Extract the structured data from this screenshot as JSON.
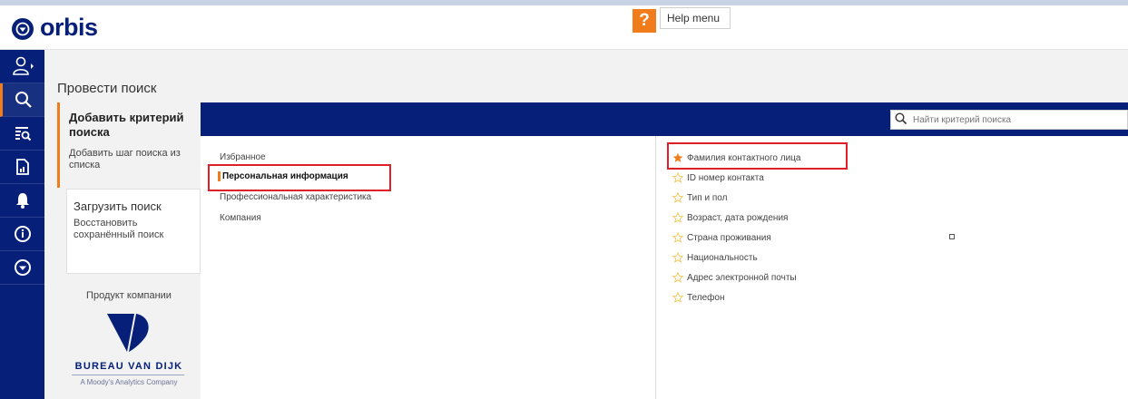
{
  "app": {
    "name": "orbis"
  },
  "header": {
    "help_icon": "?",
    "help_label": "Help menu"
  },
  "leftnav": {
    "items": [
      {
        "name": "user-icon",
        "active": false
      },
      {
        "name": "search-icon",
        "active": true
      },
      {
        "name": "search-list-icon",
        "active": false
      },
      {
        "name": "report-icon",
        "active": false
      },
      {
        "name": "bell-icon",
        "active": false
      },
      {
        "name": "info-circle-icon",
        "active": false
      },
      {
        "name": "orbis-icon",
        "active": false
      }
    ]
  },
  "page": {
    "title": "Провести поиск"
  },
  "steps": {
    "add": {
      "title": "Добавить критерий поиска",
      "desc": "Добавить шаг поиска из списка"
    },
    "load": {
      "title": "Загрузить поиск",
      "desc": "Восстановить сохранённый поиск"
    }
  },
  "footer": {
    "product_label": "Продукт компании",
    "company": "BUREAU VAN DIJK",
    "company_sub": "A Moody's Analytics Company"
  },
  "search": {
    "placeholder": "Найти критерий поиска"
  },
  "categories": [
    {
      "label": "Избранное",
      "selected": false
    },
    {
      "label": "Персональная информация",
      "selected": true
    },
    {
      "label": "Профессиональная характеристика",
      "selected": false
    },
    {
      "label": "Компания",
      "selected": false
    }
  ],
  "criteria": [
    {
      "label": "Фамилия контактного лица",
      "starred": true
    },
    {
      "label": "ID номер контакта",
      "starred": false
    },
    {
      "label": "Тип и пол",
      "starred": false
    },
    {
      "label": "Возраст, дата рождения",
      "starred": false
    },
    {
      "label": "Страна проживания",
      "starred": false
    },
    {
      "label": "Национальность",
      "starred": false
    },
    {
      "label": "Адрес электронной почты",
      "starred": false
    },
    {
      "label": "Телефон",
      "starred": false
    }
  ],
  "colors": {
    "brand_navy": "#06207a",
    "accent_orange": "#f07c1b",
    "highlight_red": "#e01f26"
  }
}
